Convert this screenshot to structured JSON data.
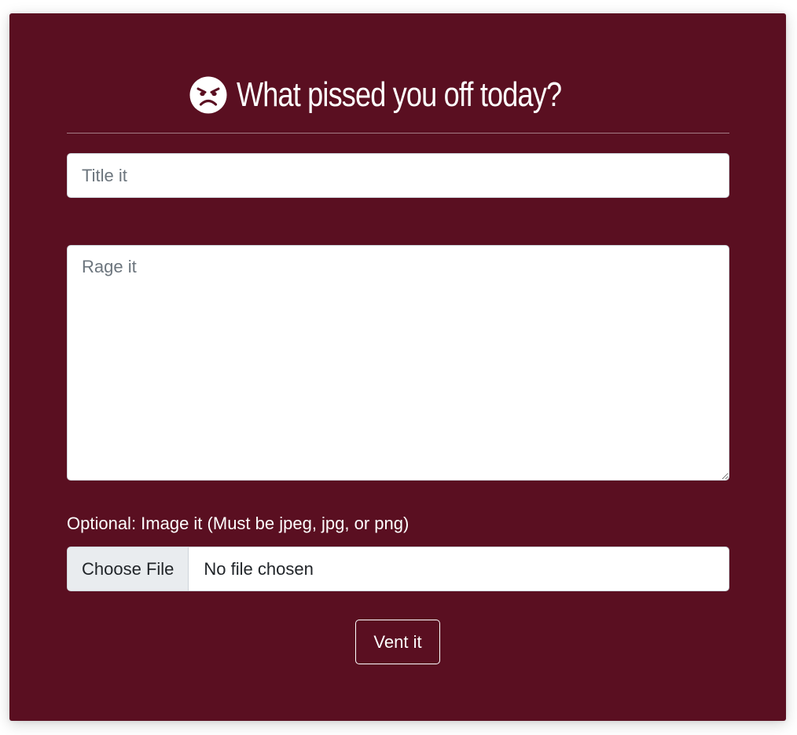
{
  "header": {
    "icon": "angry-face-icon",
    "title": "What pissed you off today?"
  },
  "form": {
    "title_placeholder": "Title it",
    "title_value": "",
    "rage_placeholder": "Rage it",
    "rage_value": "",
    "file_label": "Optional: Image it (Must be jpeg, jpg, or png)",
    "choose_file_label": "Choose File",
    "file_status": "No file chosen",
    "submit_label": "Vent it"
  },
  "colors": {
    "card_background": "#5a0f21",
    "text_on_card": "#ffffff",
    "input_border": "#ced4da",
    "file_button_background": "#e9ecef"
  }
}
